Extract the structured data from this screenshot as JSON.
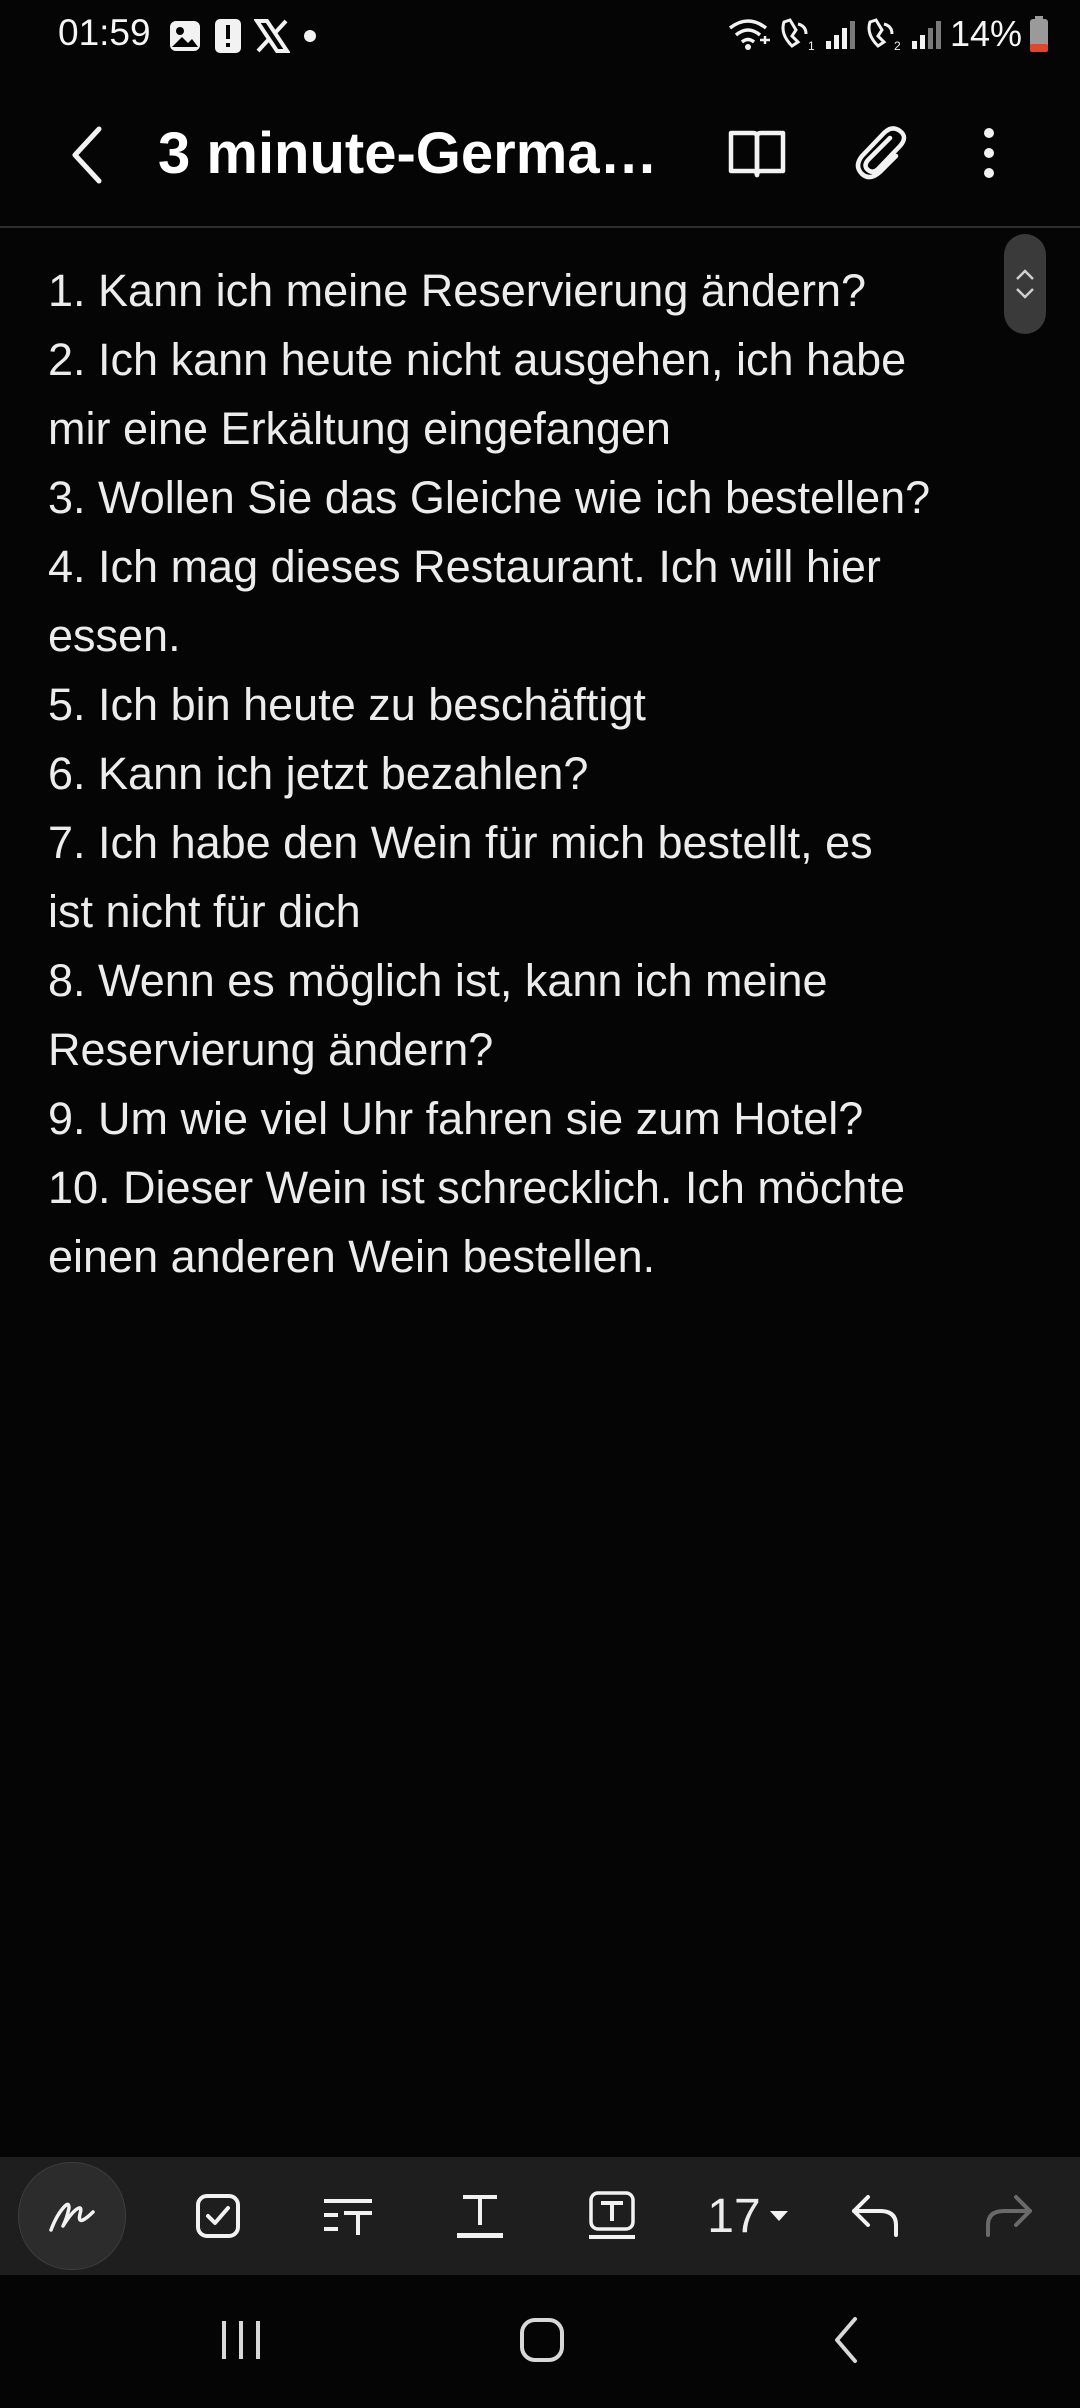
{
  "status_bar": {
    "time": "01:59",
    "battery": "14%",
    "left_icons": [
      "gallery-icon",
      "alert-icon",
      "x-app-icon",
      "dot-icon"
    ],
    "right_icons": [
      "wifi-calling-icon",
      "volte-sim1-icon",
      "signal-icon",
      "volte-sim2-icon",
      "signal-icon",
      "battery-low-icon"
    ]
  },
  "header": {
    "title": "3 minute-German..."
  },
  "note": {
    "lines": [
      "1. Kann ich meine Reservierung ändern?",
      "2. Ich kann heute nicht ausgehen, ich habe",
      "mir eine Erkältung eingefangen",
      "3. Wollen Sie das Gleiche wie ich bestellen?",
      "4. Ich mag dieses Restaurant. Ich will hier",
      "essen.",
      "5. Ich bin heute zu beschäftigt",
      "6. Kann ich jetzt bezahlen?",
      "7. Ich habe den Wein für mich bestellt, es",
      "ist nicht für dich",
      "8. Wenn es möglich ist, kann ich meine",
      "Reservierung ändern?",
      "9. Um wie viel Uhr fahren sie zum Hotel?",
      "10. Dieser Wein ist schrecklich. Ich möchte",
      "einen anderen Wein bestellen."
    ]
  },
  "toolbar": {
    "font_size": "17",
    "tools": [
      "handwriting-pen-icon",
      "checkbox-icon",
      "paragraph-style-icon",
      "text-style-icon",
      "text-box-icon",
      "font-size-dropdown",
      "undo-icon",
      "redo-icon"
    ]
  },
  "colors": {
    "background": "#050505",
    "text": "#ececec",
    "toolbar": "#1e1e1e",
    "battery_low": "#e0462a"
  }
}
